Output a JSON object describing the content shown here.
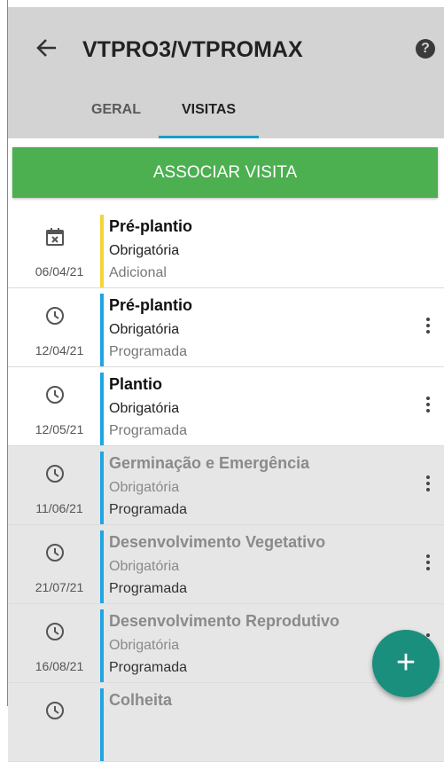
{
  "appbar": {
    "title": "VTPRO3/VTPROMAX",
    "help_icon": "help-icon",
    "back_icon": "arrow-left-icon"
  },
  "tabs": [
    {
      "label": "GERAL",
      "active": false
    },
    {
      "label": "VISITAS",
      "active": true
    }
  ],
  "associate_button": {
    "label": "ASSOCIAR VISITA"
  },
  "visits": [
    {
      "icon": "calendar-x-icon",
      "date": "06/04/21",
      "name": "Pré-plantio",
      "requirement": "Obrigatória",
      "status": "Adicional",
      "stripe": "#f2d43b",
      "dimmed": false,
      "menu": false
    },
    {
      "icon": "clock-icon",
      "date": "12/04/21",
      "name": "Pré-plantio",
      "requirement": "Obrigatória",
      "status": "Programada",
      "stripe": "#1ea5e3",
      "dimmed": false,
      "menu": true
    },
    {
      "icon": "clock-icon",
      "date": "12/05/21",
      "name": "Plantio",
      "requirement": "Obrigatória",
      "status": "Programada",
      "stripe": "#1ea5e3",
      "dimmed": false,
      "menu": true
    },
    {
      "icon": "clock-icon",
      "date": "11/06/21",
      "name": "Germinação e Emergência",
      "requirement": "Obrigatória",
      "status": "Programada",
      "stripe": "#1ea5e3",
      "dimmed": true,
      "menu": true
    },
    {
      "icon": "clock-icon",
      "date": "21/07/21",
      "name": "Desenvolvimento Vegetativo",
      "requirement": "Obrigatória",
      "status": "Programada",
      "stripe": "#1ea5e3",
      "dimmed": true,
      "menu": true
    },
    {
      "icon": "clock-icon",
      "date": "16/08/21",
      "name": "Desenvolvimento Reprodutivo",
      "requirement": "Obrigatória",
      "status": "Programada",
      "stripe": "#1ea5e3",
      "dimmed": true,
      "menu": true
    },
    {
      "icon": "clock-icon",
      "date": "",
      "name": "Colheita",
      "requirement": "",
      "status": "",
      "stripe": "#1ea5e3",
      "dimmed": true,
      "menu": false
    }
  ],
  "fab": {
    "label": "+",
    "icon": "plus-icon"
  }
}
